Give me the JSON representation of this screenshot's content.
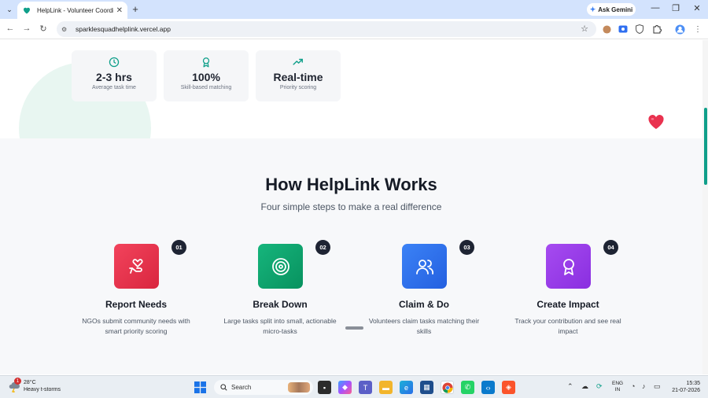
{
  "browser": {
    "tab_title": "HelpLink - Volunteer Coordinati",
    "url": "sparklesquadhelplink.vercel.app",
    "gemini_label": "Ask Gemini"
  },
  "stats": [
    {
      "value": "2-3 hrs",
      "label": "Average task time",
      "icon": "clock-icon"
    },
    {
      "value": "100%",
      "label": "Skill-based matching",
      "icon": "award-icon"
    },
    {
      "value": "Real-time",
      "label": "Priority scoring",
      "icon": "trending-up-icon"
    }
  ],
  "how": {
    "title": "How HelpLink Works",
    "subtitle": "Four simple steps to make a real difference",
    "steps": [
      {
        "num": "01",
        "title": "Report Needs",
        "desc": "NGOs submit community needs with smart priority scoring",
        "icon": "hand-heart-icon",
        "color": "#e8334f"
      },
      {
        "num": "02",
        "title": "Break Down",
        "desc": "Large tasks split into small, actionable micro-tasks",
        "icon": "target-icon",
        "color": "#0ea56f"
      },
      {
        "num": "03",
        "title": "Claim & Do",
        "desc": "Volunteers claim tasks matching their skills",
        "icon": "users-icon",
        "color": "#2f6ff0"
      },
      {
        "num": "04",
        "title": "Create Impact",
        "desc": "Track your contribution and see real impact",
        "icon": "award-icon",
        "color": "#9b3ee8"
      }
    ]
  },
  "taskbar": {
    "weather_temp": "28°C",
    "weather_desc": "Heavy t-storms",
    "weather_badge": "1",
    "search_label": "Search",
    "lang_line1": "ENG",
    "lang_line2": "IN",
    "time": "15:35",
    "date": "21-07-2026"
  },
  "colors": {
    "accent": "#0f9f8a",
    "dark": "#161b26"
  }
}
